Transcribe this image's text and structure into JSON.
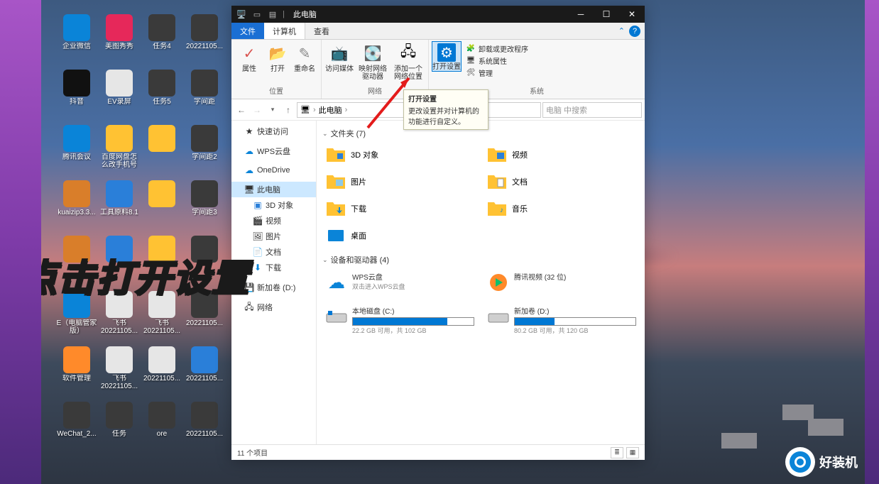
{
  "window": {
    "title": "此电脑",
    "tabs": {
      "file": "文件",
      "computer": "计算机",
      "view": "查看"
    }
  },
  "ribbon": {
    "group_location": {
      "label": "位置",
      "properties": "属性",
      "open": "打开",
      "rename": "重命名"
    },
    "group_network": {
      "label": "网络",
      "access_media": "访问媒体",
      "map_drive": "映射网络驱动器",
      "add_location": "添加一个网络位置"
    },
    "group_system": {
      "label": "系统",
      "open_settings": "打开设置",
      "uninstall": "卸载或更改程序",
      "sys_props": "系统属性",
      "manage": "管理"
    }
  },
  "tooltip": {
    "title": "打开设置",
    "body": "更改设置并对计算机的功能进行自定义。"
  },
  "address": {
    "crumb": "此电脑",
    "search_placeholder": "电脑 中搜索"
  },
  "nav": {
    "quick": "快速访问",
    "wps": "WPS云盘",
    "onedrive": "OneDrive",
    "thispc": "此电脑",
    "obj3d": "3D 对象",
    "videos": "视频",
    "pictures": "图片",
    "documents": "文档",
    "downloads": "下载",
    "newvol": "新加卷 (D:)",
    "network": "网络"
  },
  "content": {
    "folders_header": "文件夹 (7)",
    "devices_header": "设备和驱动器 (4)",
    "folders": {
      "obj3d": "3D 对象",
      "videos": "视频",
      "pictures": "图片",
      "documents": "文档",
      "downloads": "下载",
      "music": "音乐",
      "desktop": "桌面"
    },
    "devices": {
      "wps": {
        "name": "WPS云盘",
        "sub": "双击进入WPS云盘"
      },
      "tencent": {
        "name": "腾讯视频 (32 位)"
      },
      "c": {
        "name": "本地磁盘 (C:)",
        "sub": "22.2 GB 可用，共 102 GB",
        "used_pct": 78
      },
      "d": {
        "name": "新加卷 (D:)",
        "sub": "80.2 GB 可用，共 120 GB",
        "used_pct": 33
      }
    }
  },
  "status": {
    "items": "11 个项目"
  },
  "overlay_text": "点击打开设置",
  "watermark": "好装机",
  "desktop_icons": [
    {
      "label": "企业微信",
      "bg": "#0a84d8"
    },
    {
      "label": "美图秀秀",
      "bg": "#e6285a"
    },
    {
      "label": "任务4",
      "bg": "#3a3a3a"
    },
    {
      "label": "20221105...",
      "bg": "#3a3a3a"
    },
    {
      "label": "抖音",
      "bg": "#111"
    },
    {
      "label": "EV录屏",
      "bg": "#e6e6e6"
    },
    {
      "label": "任务5",
      "bg": "#3a3a3a"
    },
    {
      "label": "字间距",
      "bg": "#3a3a3a"
    },
    {
      "label": "腾讯会议",
      "bg": "#0a84d8"
    },
    {
      "label": "百度网盘怎么改手机号绑定",
      "bg": "#ffc233"
    },
    {
      "label": "",
      "bg": "#ffc233"
    },
    {
      "label": "字间距2",
      "bg": "#3a3a3a"
    },
    {
      "label": "kuaizip3.3...",
      "bg": "#d97e2a"
    },
    {
      "label": "工具原料8.1",
      "bg": "#2a7fd9"
    },
    {
      "label": "",
      "bg": "#ffc233"
    },
    {
      "label": "字间距3",
      "bg": "#3a3a3a"
    },
    {
      "label": "",
      "bg": "#d97e2a"
    },
    {
      "label": "",
      "bg": "#2a7fd9"
    },
    {
      "label": "",
      "bg": "#ffc233"
    },
    {
      "label": "",
      "bg": "#3a3a3a"
    },
    {
      "label": "E（电脑管家 版）",
      "bg": "#0a84d8"
    },
    {
      "label": "飞书20221105...",
      "bg": "#e6e6e6"
    },
    {
      "label": "飞书20221105...",
      "bg": "#e6e6e6"
    },
    {
      "label": "20221105...",
      "bg": "#3a3a3a"
    },
    {
      "label": "软件管理",
      "bg": "#ff8a2a"
    },
    {
      "label": "飞书20221105...",
      "bg": "#e6e6e6"
    },
    {
      "label": "20221105...",
      "bg": "#e6e6e6"
    },
    {
      "label": "20221105...",
      "bg": "#2a7fd9"
    },
    {
      "label": "WeChat_2...",
      "bg": "#3a3a3a"
    },
    {
      "label": "任务",
      "bg": "#3a3a3a"
    },
    {
      "label": "ore",
      "bg": "#3a3a3a"
    },
    {
      "label": "20221105...",
      "bg": "#3a3a3a"
    }
  ]
}
